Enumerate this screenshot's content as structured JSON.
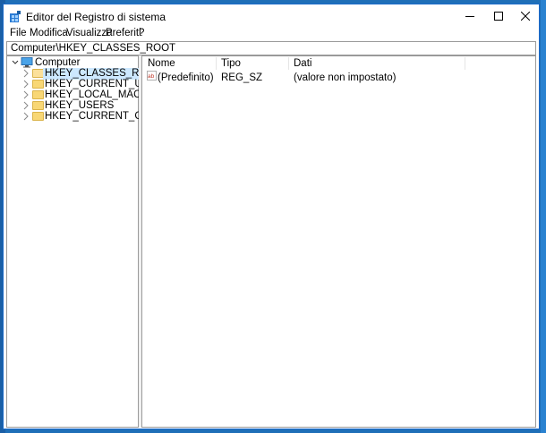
{
  "window": {
    "title": "Editor del Registro di sistema"
  },
  "menu": [
    "File",
    "Modifica",
    "Visualizza",
    "Preferiti",
    "?"
  ],
  "address": "Computer\\HKEY_CLASSES_ROOT",
  "tree": {
    "root": "Computer",
    "items": [
      {
        "label": "HKEY_CLASSES_ROOT",
        "selected": true
      },
      {
        "label": "HKEY_CURRENT_USER",
        "selected": false
      },
      {
        "label": "HKEY_LOCAL_MACHINE",
        "selected": false
      },
      {
        "label": "HKEY_USERS",
        "selected": false
      },
      {
        "label": "HKEY_CURRENT_CONFIG",
        "selected": false
      }
    ]
  },
  "list": {
    "columns": [
      "Nome",
      "Tipo",
      "Dati"
    ],
    "rows": [
      {
        "name": "(Predefinito)",
        "type": "REG_SZ",
        "data": "(valore non impostato)",
        "icon": "string-value-icon"
      }
    ]
  },
  "colors": {
    "accent": "#1b6ac9",
    "selection": "#cce8ff",
    "folder": "#f8d775"
  }
}
